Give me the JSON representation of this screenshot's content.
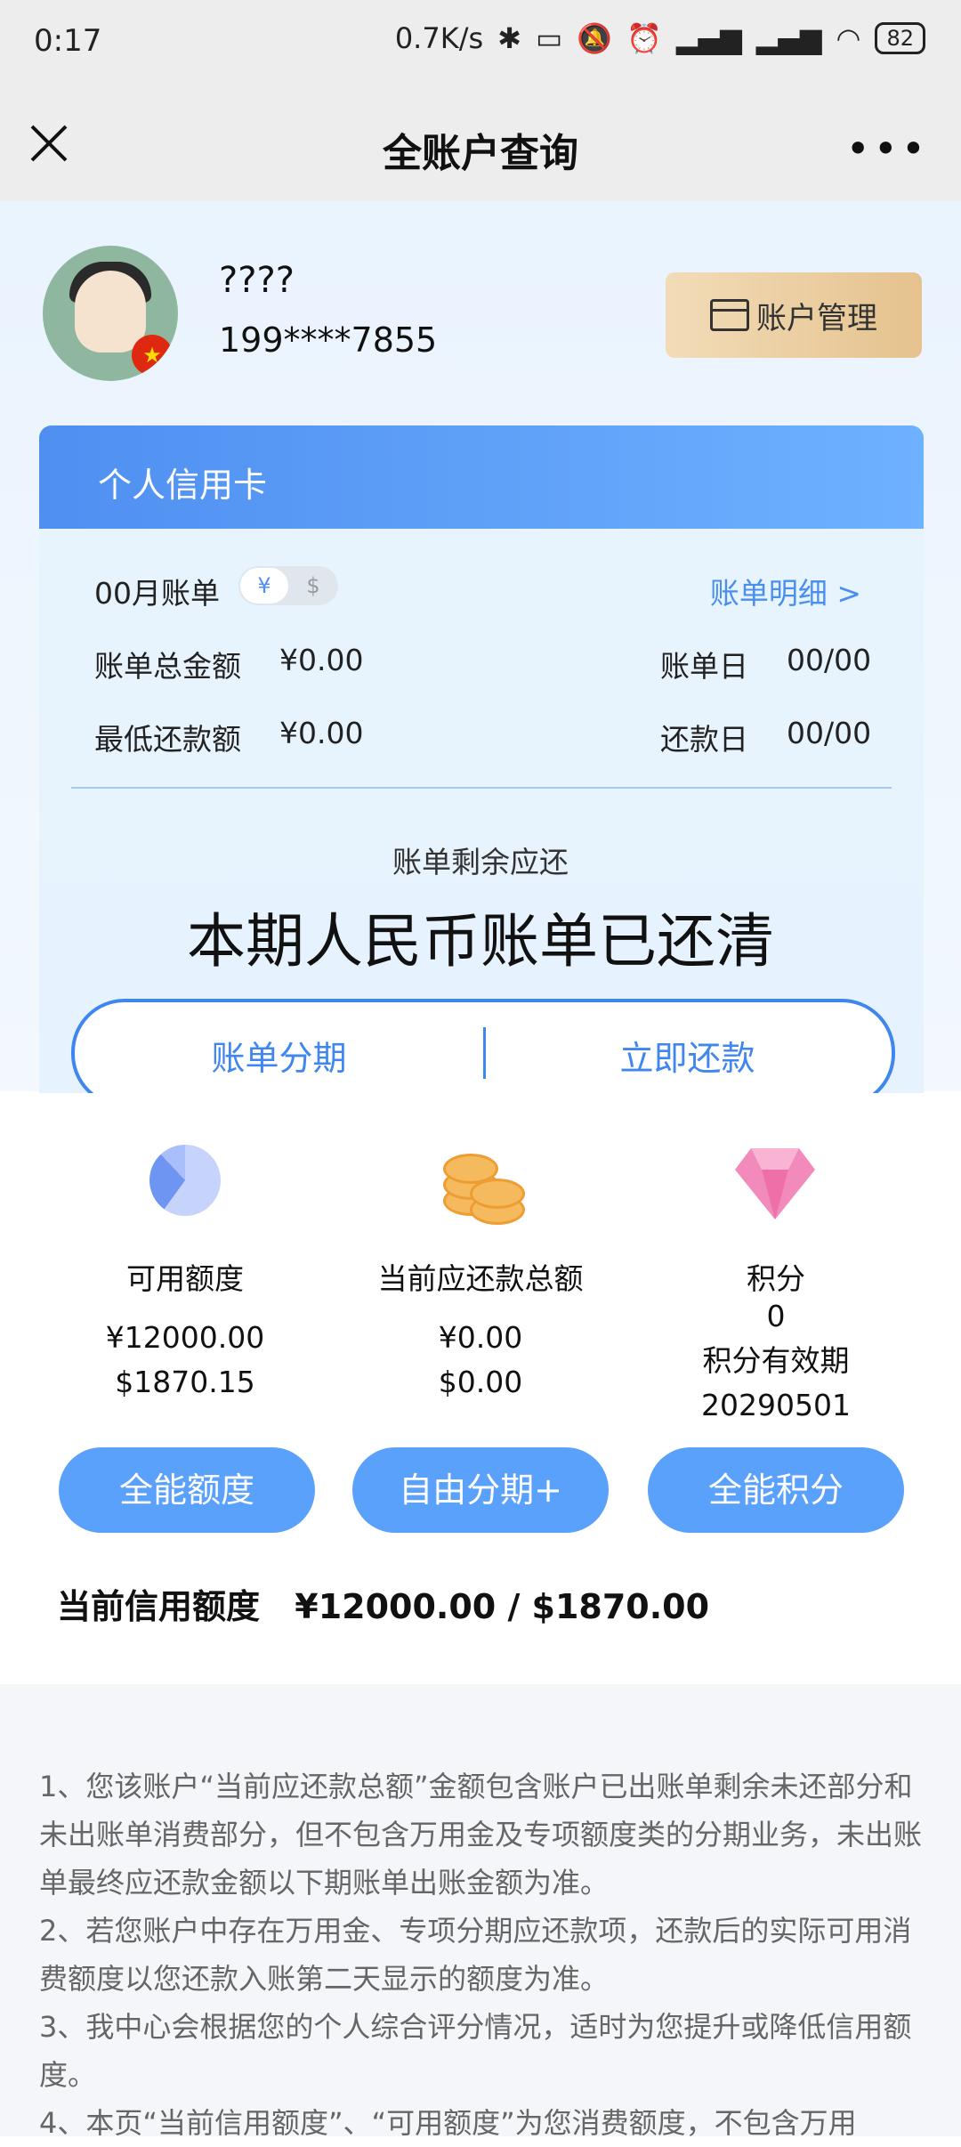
{
  "status_bar": {
    "time": "0:17",
    "net_speed": "0.7K/s",
    "battery": "82"
  },
  "header": {
    "title": "全账户查询"
  },
  "profile": {
    "name": "????",
    "phone": "199****7855",
    "account_button": "账户管理"
  },
  "card_panel": {
    "title": "个人信用卡",
    "month_bill": "00月账单",
    "currency_rmb": "¥",
    "currency_usd": "$",
    "detail_link": "账单明细 >",
    "total_label": "账单总金额",
    "total_value": "¥0.00",
    "min_label": "最低还款额",
    "min_value": "¥0.00",
    "bill_day_label": "账单日",
    "bill_day_value": "00/00",
    "due_day_label": "还款日",
    "due_day_value": "00/00",
    "remaining_label": "账单剩余应还",
    "status_text": "本期人民币账单已还清",
    "installment_action": "账单分期",
    "repay_action": "立即还款"
  },
  "stats": {
    "available": {
      "label": "可用额度",
      "rmb": "¥12000.00",
      "usd": "$1870.15"
    },
    "due_total": {
      "label": "当前应还款总额",
      "rmb": "¥0.00",
      "usd": "$0.00"
    },
    "points": {
      "label": "积分",
      "value": "0",
      "expiry_label": "积分有效期",
      "expiry_value": "20290501"
    }
  },
  "action_buttons": {
    "limit": "全能额度",
    "installment": "自由分期+",
    "points": "全能积分"
  },
  "credit_line": {
    "label": "当前信用额度",
    "value": "¥12000.00 / $1870.00"
  },
  "notes": [
    "1、您该账户“当前应还款总额”金额包含账户已出账单剩余未还部分和未出账单消费部分，但不包含万用金及专项额度类的分期业务，未出账单最终应还款金额以下期账单出账金额为准。",
    "2、若您账户中存在万用金、专项分期应还款项，还款后的实际可用消费额度以您还款入账第二天显示的额度为准。",
    "3、我中心会根据您的个人综合评分情况，适时为您提升或降低信用额度。",
    "4、本页“当前信用额度”、“可用额度”为您消费额度，不包含万用"
  ],
  "colors": {
    "accent_blue": "#4f8ff1",
    "button_blue": "#5aa1fb",
    "gold_button": "#e5c28e"
  }
}
